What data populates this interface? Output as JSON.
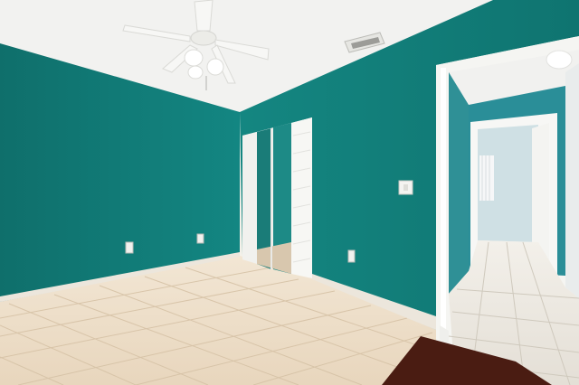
{
  "scene": {
    "description_only_visual": true
  },
  "colors": {
    "wall_teal": "#127c78",
    "wall_teal_dark": "#0e6a67",
    "wall_teal_light": "#1a8c86",
    "ceiling": "#f3f3f1",
    "tile": "#efe2cf",
    "tile_grout": "#d8c6ae",
    "baseboard": "#ece6dc",
    "door_frame": "#f5f5f2",
    "hall_wall": "#cfe2e6",
    "hall_wall_teal": "#2a8f98",
    "rug": "#4a1c12"
  },
  "icons": [
    "ceiling-fan-icon",
    "air-vent-icon",
    "light-switch-icon",
    "power-outlet-icon"
  ]
}
